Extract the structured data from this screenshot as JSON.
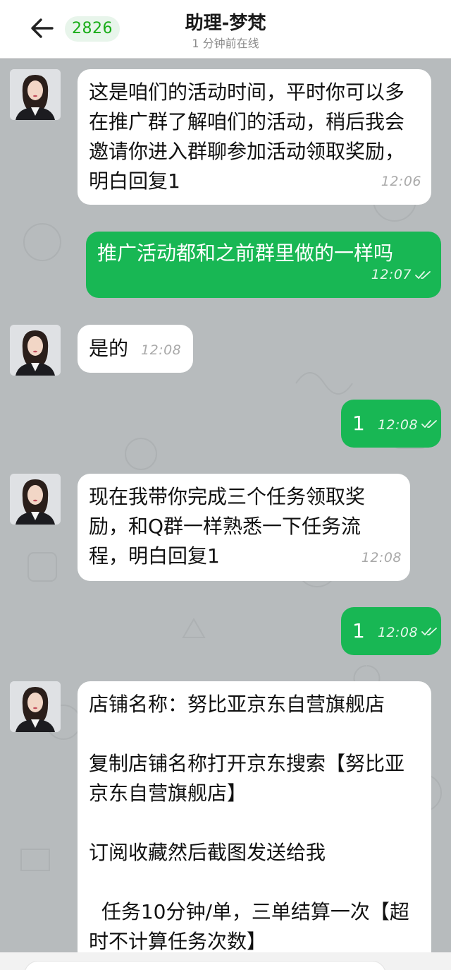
{
  "header": {
    "back_icon": "arrow-left-icon",
    "unread_count": "2826",
    "contact_name": "助理-梦梵",
    "status": "1 分钟前在线"
  },
  "colors": {
    "accent": "#1aad19",
    "outgoing_bubble": "#18b754",
    "incoming_bubble": "#ffffff",
    "chat_background": "#b7bbbd"
  },
  "messages": [
    {
      "direction": "in",
      "text": "这是咱们的活动时间，平时你可以多在推广群了解咱们的活动，稍后我会邀请你进入群聊参加活动领取奖励，明白回复1",
      "time": "12:06"
    },
    {
      "direction": "out",
      "text": "推广活动都和之前群里做的一样吗",
      "time": "12:07",
      "read_icon": "double-check-icon"
    },
    {
      "direction": "in",
      "text": "是的",
      "time": "12:08"
    },
    {
      "direction": "out",
      "text": "1",
      "time": "12:08",
      "read_icon": "double-check-icon"
    },
    {
      "direction": "in",
      "text": "现在我带你完成三个任务领取奖励，和Q群一样熟悉一下任务流程，明白回复1",
      "time": "12:08"
    },
    {
      "direction": "out",
      "text": "1",
      "time": "12:08",
      "read_icon": "double-check-icon"
    },
    {
      "direction": "in",
      "text": "店铺名称：努比亚京东自营旗舰店\n\n复制店铺名称打开京东搜索【努比亚京东自营旗舰店】\n\n订阅收藏然后截图发送给我\n\n  任务10分钟/单，三单结算一次【超时不计算任务次数】",
      "time": ""
    }
  ]
}
